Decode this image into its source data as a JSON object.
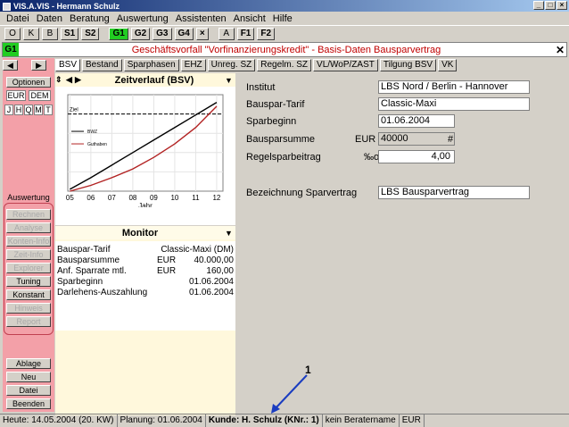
{
  "window": {
    "title": "VIS.A.VIS - Hermann Schulz"
  },
  "menu": [
    "Datei",
    "Daten",
    "Beratung",
    "Auswertung",
    "Assistenten",
    "Ansicht",
    "Hilfe"
  ],
  "toolbar": [
    "O",
    "K",
    "B",
    "S1",
    "S2",
    "G1",
    "G2",
    "G3",
    "G4",
    "×",
    "A",
    "F1",
    "F2"
  ],
  "caption": {
    "tag": "G1",
    "text": "Geschäftsvorfall \"Vorfinanzierungskredit\" - Basis-Daten Bausparvertrag",
    "close": "✕"
  },
  "sidebar": {
    "optionen": "Optionen",
    "currency": [
      "EUR",
      "DEM"
    ],
    "period": [
      "J",
      "H",
      "Q",
      "M",
      "T"
    ],
    "auswertung_label": "Auswertung",
    "buttons": [
      "Rechnen",
      "Analyse",
      "Konten-Info",
      "Zeit-Info",
      "Explorer",
      "Tuning",
      "Konstant",
      "Hinweis",
      "Report"
    ],
    "bottom_buttons": [
      "Ablage",
      "Neu",
      "Datei",
      "Beenden"
    ]
  },
  "tabs": [
    "BSV",
    "Bestand",
    "Sparphasen",
    "EHZ",
    "Unreg. SZ",
    "Regelm. SZ",
    "VL/WoP/ZAST",
    "Tilgung BSV",
    "VK"
  ],
  "zeitverlauf": {
    "title": "Zeitverlauf (BSV)"
  },
  "chart_data": {
    "type": "line",
    "x": [
      5,
      6,
      7,
      8,
      9,
      10,
      11,
      12
    ],
    "xlabel": "Jahr",
    "tick_labels": [
      "05",
      "06",
      "07",
      "08",
      "09",
      "10",
      "11",
      "12"
    ],
    "threshold_label": "Ziel",
    "series": [
      {
        "name": "BWZ",
        "values": [
          2,
          14,
          27,
          40,
          53,
          66,
          79,
          92
        ],
        "color": "#000000"
      },
      {
        "name": "Guthaben",
        "values": [
          0,
          6,
          14,
          23,
          35,
          49,
          66,
          88
        ],
        "color": "#b22222"
      }
    ],
    "target": 80
  },
  "monitor": {
    "title": "Monitor",
    "rows": [
      {
        "label": "Bauspar-Tarif",
        "unit": "",
        "value": "Classic-Maxi  (DM)"
      },
      {
        "label": "Bausparsumme",
        "unit": "EUR",
        "value": "40.000,00"
      },
      {
        "label": "Anf. Sparrate mtl.",
        "unit": "EUR",
        "value": "160,00"
      },
      {
        "label": "Sparbeginn",
        "unit": "",
        "value": "01.06.2004"
      },
      {
        "label": "Darlehens-Auszahlung",
        "unit": "",
        "value": "01.06.2004"
      }
    ]
  },
  "form": {
    "institut_label": "Institut",
    "institut": "LBS Nord / Berlin - Hannover",
    "tarif_label": "Bauspar-Tarif",
    "tarif": "Classic-Maxi",
    "sparbeginn_label": "Sparbeginn",
    "sparbeginn": "01.06.2004",
    "summe_label": "Bausparsumme",
    "summe_unit": "EUR",
    "summe": "40000",
    "summe_hash": "#",
    "regel_label": "Regelsparbeitrag",
    "regel_unit": "‰o",
    "regel": "4,00",
    "bez_label": "Bezeichnung Sparvertrag",
    "bez": "LBS Bausparvertrag"
  },
  "status": [
    "Heute: 14.05.2004 (20. KW)",
    "Planung: 01.06.2004",
    "Kunde: H. Schulz (KNr.: 1)",
    "kein Beratername",
    "EUR"
  ],
  "annotation": "1"
}
